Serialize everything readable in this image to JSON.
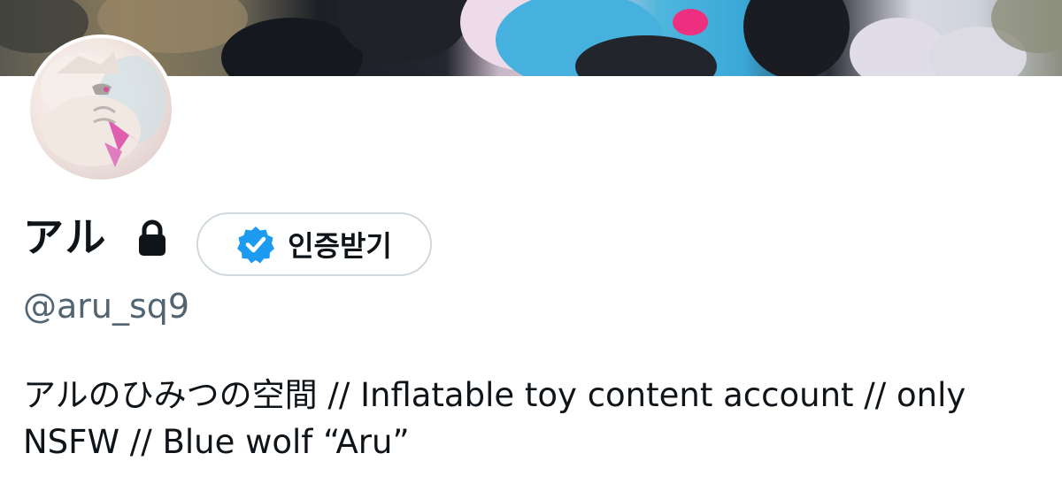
{
  "profile": {
    "display_name": "アル",
    "verify_button_label": "인증받기",
    "handle": "@aru_sq9",
    "bio": "アルのひみつの空間 // Inflatable toy content account // only NSFW // Blue wolf “Aru”"
  },
  "icons": {
    "lock": "lock-icon",
    "verified_badge": "verified-badge-icon"
  },
  "colors": {
    "text_primary": "#0f1419",
    "text_secondary": "#536471",
    "verified_blue": "#1d9bf0",
    "button_border": "#cfd9de"
  }
}
